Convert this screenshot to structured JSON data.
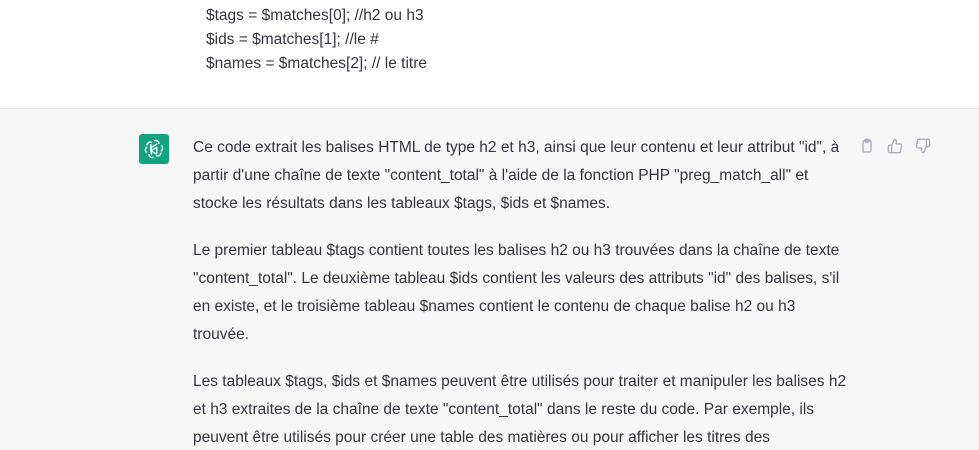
{
  "user_message": {
    "code_lines": [
      "$tags = $matches[0]; //h2 ou h3",
      "$ids = $matches[1]; //le #",
      "$names = $matches[2]; // le titre"
    ]
  },
  "assistant_message": {
    "paragraphs": [
      "Ce code extrait les balises HTML de type h2 et h3, ainsi que leur contenu et leur attribut \"id\", à partir d'une chaîne de texte \"content_total\" à l'aide de la fonction PHP \"preg_match_all\" et stocke les résultats dans les tableaux $tags, $ids et $names.",
      "Le premier tableau $tags contient toutes les balises h2 ou h3 trouvées dans la chaîne de texte \"content_total\". Le deuxième tableau $ids contient les valeurs des attributs \"id\" des balises, s'il en existe, et le troisième tableau $names contient le contenu de chaque balise h2 ou h3 trouvée.",
      "Les tableaux $tags, $ids et $names peuvent être utilisés pour traiter et manipuler les balises h2 et h3 extraites de la chaîne de texte \"content_total\" dans le reste du code. Par exemple, ils peuvent être utilisés pour créer une table des matières ou pour afficher les titres des"
    ],
    "avatar_icon": "openai-logo-icon",
    "actions": [
      {
        "icon": "clipboard-icon"
      },
      {
        "icon": "thumbs-up-icon"
      },
      {
        "icon": "thumbs-down-icon"
      }
    ]
  },
  "colors": {
    "assistant_bg": "#f7f7f8",
    "avatar_bg": "#10a37f",
    "text": "#343541",
    "icon": "#acacbe"
  }
}
